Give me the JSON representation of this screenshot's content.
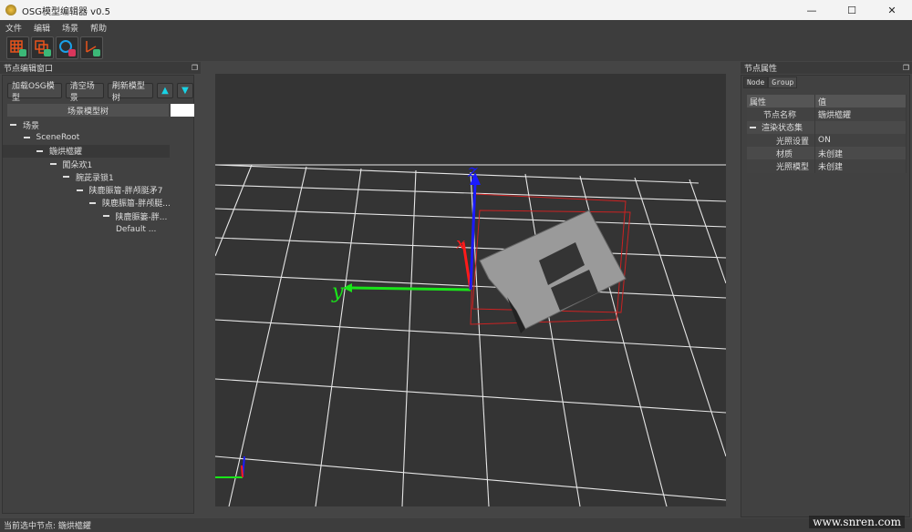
{
  "window": {
    "title": "OSG模型编辑器 v0.5",
    "minimize": "—",
    "maximize": "☐",
    "close": "✕"
  },
  "menu": [
    "文件",
    "编辑",
    "场景",
    "帮助"
  ],
  "toolbar": [
    "grid-icon",
    "cube-icon",
    "circle-icon",
    "axis-icon"
  ],
  "left_panel": {
    "title": "节点编辑窗口",
    "buttons": {
      "load": "加载OSG模型",
      "clear": "清空场景",
      "refresh": "刷新模型树",
      "up": "▲",
      "down": "▼"
    },
    "tree_header": "场景模型树",
    "tree": [
      {
        "label": "场景",
        "depth": 0
      },
      {
        "label": "SceneRoot",
        "depth": 1
      },
      {
        "label": "鍦烘櫙鑺",
        "depth": 2,
        "selected": true
      },
      {
        "label": "闖朵欢1",
        "depth": 3
      },
      {
        "label": "腕茈录锁1",
        "depth": 4
      },
      {
        "label": "陕鹿脤篃-胖颅脡矛7",
        "depth": 5
      },
      {
        "label": "陕鹿脤篃-胖颅脡...",
        "depth": 6
      },
      {
        "label": "陕鹿脤篓-胖...",
        "depth": 7
      },
      {
        "label": "Default ...",
        "depth": 8,
        "leaf": true
      }
    ]
  },
  "viewport": {
    "axis_x": "x",
    "axis_y": "y",
    "axis_z": "z",
    "colors": {
      "x": "#ff1a1a",
      "y": "#19e619",
      "z": "#1a1aff",
      "grid": "#ffffff",
      "bbox": "#cc2222",
      "model": "#9a9a9a"
    }
  },
  "right_panel": {
    "title": "节点属性",
    "tabs": [
      "Node",
      "Group"
    ],
    "header": [
      "属性",
      "值"
    ],
    "rows": [
      {
        "name": "节点名称",
        "value": "鍦烘櫙鑺",
        "indent": 1
      },
      {
        "name": "渲染状态集",
        "value": "",
        "indent": 0,
        "group": true
      },
      {
        "name": "光照设置",
        "value": "ON",
        "indent": 2
      },
      {
        "name": "材质",
        "value": "未创建",
        "indent": 2
      },
      {
        "name": "光照模型",
        "value": "未创建",
        "indent": 2
      }
    ]
  },
  "status": {
    "text": "当前选中节点: 鍦烘櫙鑺"
  },
  "watermark": "www.snren.com"
}
